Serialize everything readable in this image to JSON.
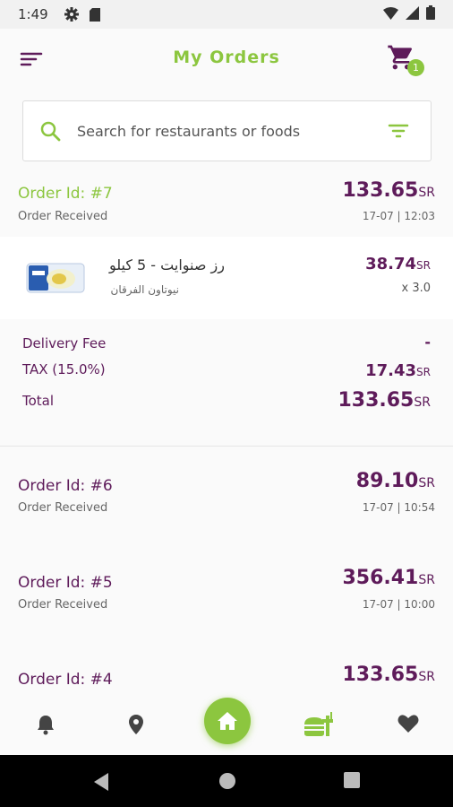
{
  "status_bar": {
    "time": "1:49"
  },
  "header": {
    "title": "My Orders",
    "cart_count": "1"
  },
  "search": {
    "placeholder": "Search for restaurants or foods"
  },
  "orders": [
    {
      "id": "Order Id: #7",
      "status": "Order Received",
      "price": "133.65",
      "currency": "SR",
      "date": "17-07 | 12:03"
    },
    {
      "id": "Order Id: #6",
      "status": "Order Received",
      "price": "89.10",
      "currency": "SR",
      "date": "17-07 | 10:54"
    },
    {
      "id": "Order Id: #5",
      "status": "Order Received",
      "price": "356.41",
      "currency": "SR",
      "date": "17-07 | 10:00"
    },
    {
      "id": "Order Id: #4",
      "price": "133.65",
      "currency": "SR"
    }
  ],
  "order_item": {
    "name": "رز صنوايت - 5 كيلو",
    "store": "نيوتاون الفرقان",
    "price": "38.74",
    "currency": "SR",
    "quantity": "x 3.0"
  },
  "summary": {
    "delivery_label": "Delivery Fee",
    "delivery_value": "-",
    "tax_label": "TAX (15.0%)",
    "tax_value": "17.43",
    "total_label": "Total",
    "total_value": "133.65",
    "currency": "SR"
  },
  "colors": {
    "accent": "#8cc63f",
    "primary": "#5e1b5a"
  },
  "bottom_nav": [
    "bell-icon",
    "location-icon",
    "home-icon",
    "food-icon",
    "heart-icon"
  ]
}
